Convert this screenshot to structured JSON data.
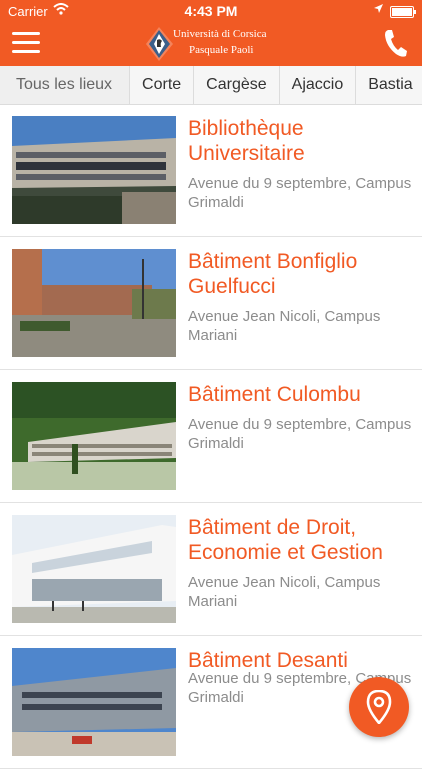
{
  "status_bar": {
    "carrier": "Carrier",
    "time": "4:43 PM"
  },
  "header": {
    "logo_line1": "Università di Corsica",
    "logo_line2": "Pasquale Paoli",
    "icons": {
      "menu": "menu-icon",
      "phone": "phone-icon"
    },
    "color": "#f15a24"
  },
  "tabs": [
    {
      "label": "Tous les lieux",
      "active": true
    },
    {
      "label": "Corte"
    },
    {
      "label": "Cargèse"
    },
    {
      "label": "Ajaccio"
    },
    {
      "label": "Bastia"
    }
  ],
  "places": [
    {
      "title": "Bibliothèque Universitaire",
      "address": "Avenue du 9 septembre, Campus Grimaldi"
    },
    {
      "title": "Bâtiment Bonfiglio Guelfucci",
      "address": "Avenue Jean Nicoli, Campus Mariani"
    },
    {
      "title": "Bâtiment Culombu",
      "address": "Avenue du 9 septembre, Campus Grimaldi"
    },
    {
      "title": "Bâtiment de Droit, Economie et Gestion",
      "address": "Avenue Jean Nicoli, Campus Mariani"
    },
    {
      "title": "Bâtiment Desanti",
      "address": "Avenue du 9 septembre, Campus Grimaldi"
    }
  ],
  "fab": {
    "icon": "location-pin-icon"
  }
}
